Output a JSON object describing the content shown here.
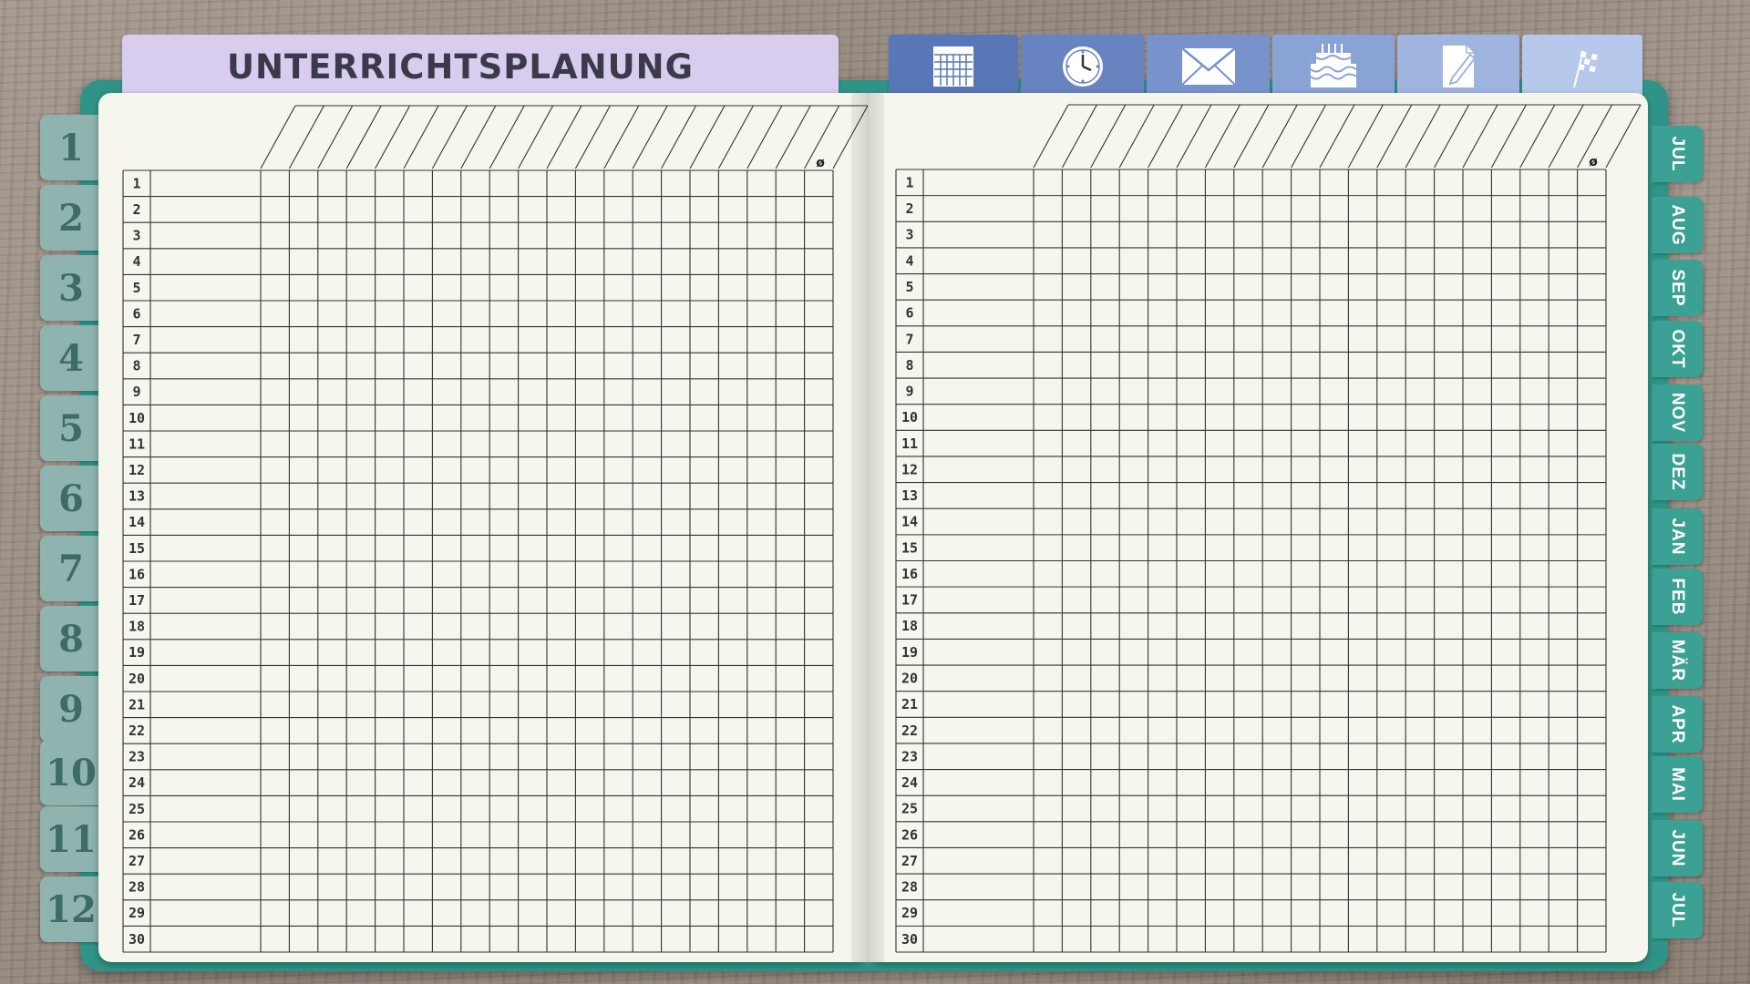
{
  "header": {
    "title": "UNTERRICHTSPLANUNG",
    "icon_tabs": [
      {
        "name": "calendar-tab",
        "icon": "calendar-icon"
      },
      {
        "name": "clock-tab",
        "icon": "clock-icon"
      },
      {
        "name": "mail-tab",
        "icon": "envelope-icon"
      },
      {
        "name": "birthday-tab",
        "icon": "cake-icon"
      },
      {
        "name": "notes-tab",
        "icon": "note-pencil-icon"
      },
      {
        "name": "goal-tab",
        "icon": "checkered-flag-icon"
      }
    ]
  },
  "number_tabs": [
    "1",
    "2",
    "3",
    "4",
    "5",
    "6",
    "7",
    "8",
    "9",
    "10",
    "11",
    "12"
  ],
  "month_tabs": [
    "JUL",
    "AUG",
    "SEP",
    "OKT",
    "NOV",
    "DEZ",
    "JAN",
    "FEB",
    "MÄR",
    "APR",
    "MAI",
    "JUN",
    "JUL"
  ],
  "grid": {
    "rows": [
      "1",
      "2",
      "3",
      "4",
      "5",
      "6",
      "7",
      "8",
      "9",
      "10",
      "11",
      "12",
      "13",
      "14",
      "15",
      "16",
      "17",
      "18",
      "19",
      "20",
      "21",
      "22",
      "23",
      "24",
      "25",
      "26",
      "27",
      "28",
      "29",
      "30"
    ],
    "average_symbol": "ø"
  },
  "colors": {
    "binder": "#2f9487",
    "title_tab": "#d8ccef",
    "number_tab": "#8fb3ae",
    "month_tab": "#3aa194",
    "paper": "#f6f5ee"
  }
}
